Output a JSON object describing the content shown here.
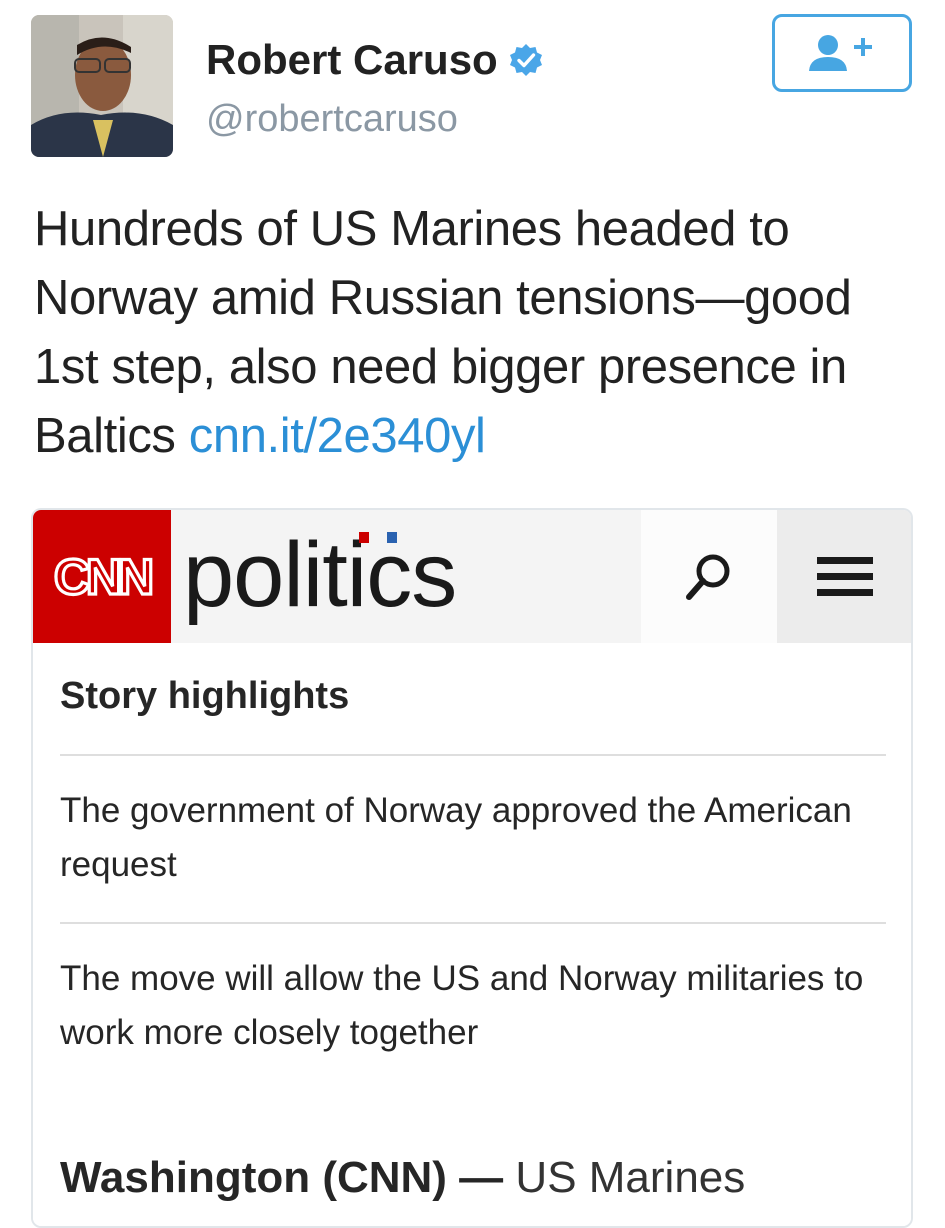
{
  "tweet": {
    "display_name": "Robert Caruso",
    "handle": "@robertcaruso",
    "text": "Hundreds of US Marines headed to Norway amid Russian tensions—good 1st step, also need bigger presence in Baltics",
    "link": "cnn.it/2e340yl",
    "verified_icon": "verified-badge-icon",
    "follow_icon": "follow-user-plus-icon"
  },
  "card": {
    "logo_text": "CNN",
    "section": "politics",
    "search_icon": "search-icon",
    "menu_icon": "hamburger-menu-icon",
    "highlights_title": "Story highlights",
    "highlights": [
      "The government of Norway approved the American request",
      "The move will allow the US and Norway militaries to work more closely together"
    ],
    "dateline": "Washington (CNN) —",
    "lede": "US Marines"
  },
  "colors": {
    "link": "#2b8fd6",
    "verified": "#4aa6e8",
    "cnn_red": "#cc0000",
    "follow_border": "#47a6e2"
  }
}
